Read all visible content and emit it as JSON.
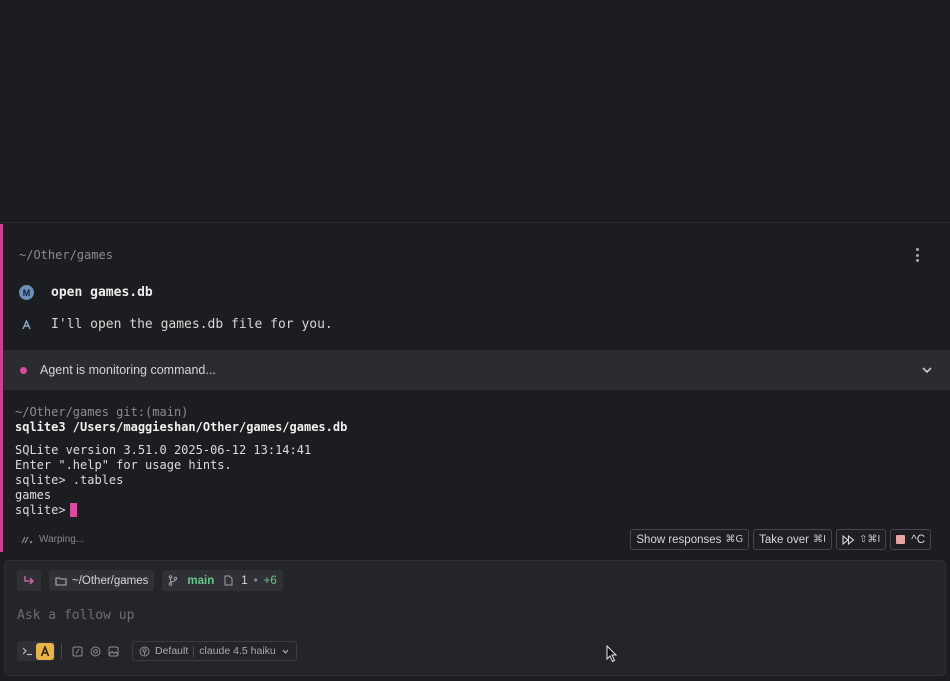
{
  "agent": {
    "path": "~/Other/games",
    "user_initial": "M",
    "user_message": "open games.db",
    "agent_message": "I'll open the games.db file for you.",
    "monitor_text": "Agent is monitoring command..."
  },
  "terminal": {
    "prompt_line": "~/Other/games git:(main)",
    "command": "sqlite3 /Users/maggieshan/Other/games/games.db",
    "output": [
      "SQLite version 3.51.0 2025-06-12 13:14:41",
      "Enter \".help\" for usage hints.",
      "sqlite> .tables",
      "games"
    ],
    "current_prompt": "sqlite>"
  },
  "status": {
    "warping_text": "Warping..."
  },
  "actions": {
    "show_responses": "Show responses",
    "show_responses_kbd": "⌘G",
    "take_over": "Take over",
    "take_over_kbd": "⌘I",
    "fast_forward_kbd": "⇧⌘I",
    "stop_kbd": "^C"
  },
  "context": {
    "directory": "~/Other/games",
    "branch": "main",
    "files_changed": "1",
    "diff_plus": "+6"
  },
  "input": {
    "placeholder": "Ask a follow up"
  },
  "model": {
    "profile": "Default",
    "name": "claude 4.5 haiku"
  },
  "colors": {
    "accent": "#c9408f",
    "monitor_dot": "#d94ba0",
    "git_green": "#67c586",
    "agent_mode": "#e8b44a"
  }
}
